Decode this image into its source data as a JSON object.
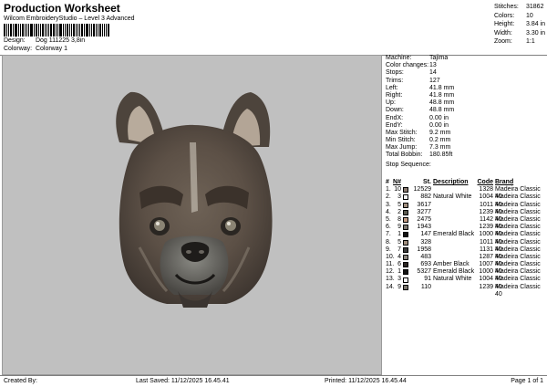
{
  "header": {
    "title": "Production Worksheet",
    "subtitle": "Wilcom EmbroideryStudio – Level 3 Advanced",
    "design_label": "Design:",
    "design_value": "Dog 111225 3,8in",
    "colorway_label": "Colorway:",
    "colorway_value": "Colorway 1"
  },
  "stats": [
    {
      "label": "Stitches:",
      "value": "31862"
    },
    {
      "label": "Colors:",
      "value": "10"
    },
    {
      "label": "Height:",
      "value": "3.84 in"
    },
    {
      "label": "Width:",
      "value": "3.30 in"
    },
    {
      "label": "Zoom:",
      "value": "1:1"
    }
  ],
  "specs": [
    {
      "label": "Machine:",
      "value": "Tajima"
    },
    {
      "label": "Color changes:",
      "value": "13"
    },
    {
      "label": "Stops:",
      "value": "14"
    },
    {
      "label": "Trims:",
      "value": "127"
    },
    {
      "label": "Left:",
      "value": "41.8 mm"
    },
    {
      "label": "Right:",
      "value": "41.8 mm"
    },
    {
      "label": "Up:",
      "value": "48.8 mm"
    },
    {
      "label": "Down:",
      "value": "48.8 mm"
    },
    {
      "label": "EndX:",
      "value": "0.00 in"
    },
    {
      "label": "EndY:",
      "value": "0.00 in"
    },
    {
      "label": "Max Stitch:",
      "value": "9.2 mm"
    },
    {
      "label": "Min Stitch:",
      "value": "0.2 mm"
    },
    {
      "label": "Max Jump:",
      "value": "7.3 mm"
    },
    {
      "label": "Total Bobbin:",
      "value": "180.85ft"
    }
  ],
  "stop_sequence": {
    "title": "Stop Sequence:",
    "headers": {
      "hash": "#",
      "n": "N#",
      "st": "St.",
      "desc": "Description",
      "code": "Code",
      "brand": "Brand"
    },
    "rows": [
      {
        "hash": "1.",
        "n": "10",
        "color": "#8a7a70",
        "st": "12529",
        "desc": "",
        "code": "1328",
        "brand": "Madeira Classic 40"
      },
      {
        "hash": "2.",
        "n": "3",
        "color": "#f4f4f4",
        "st": "882",
        "desc": "Natural White",
        "code": "1004",
        "brand": "Madeira Classic 40"
      },
      {
        "hash": "3.",
        "n": "5",
        "color": "#a08e7e",
        "st": "3617",
        "desc": "",
        "code": "1011",
        "brand": "Madeira Classic 40"
      },
      {
        "hash": "4.",
        "n": "2",
        "color": "#5b5a50",
        "st": "3277",
        "desc": "",
        "code": "1239",
        "brand": "Madeira Classic 40"
      },
      {
        "hash": "5.",
        "n": "8",
        "color": "#c19a82",
        "st": "2475",
        "desc": "",
        "code": "1142",
        "brand": "Madeira Classic 40"
      },
      {
        "hash": "6.",
        "n": "9",
        "color": "#7b766e",
        "st": "1943",
        "desc": "",
        "code": "1239",
        "brand": "Madeira Classic 40"
      },
      {
        "hash": "7.",
        "n": "1",
        "color": "#111111",
        "st": "147",
        "desc": "Emerald Black",
        "code": "1000",
        "brand": "Madeira Classic 40"
      },
      {
        "hash": "8.",
        "n": "5",
        "color": "#a08e7e",
        "st": "328",
        "desc": "",
        "code": "1011",
        "brand": "Madeira Classic 40"
      },
      {
        "hash": "9.",
        "n": "7",
        "color": "#3a3a3a",
        "st": "1958",
        "desc": "",
        "code": "1131",
        "brand": "Madeira Classic 40"
      },
      {
        "hash": "10.",
        "n": "4",
        "color": "#8b857d",
        "st": "483",
        "desc": "",
        "code": "1287",
        "brand": "Madeira Classic 40"
      },
      {
        "hash": "11.",
        "n": "6",
        "color": "#2a2522",
        "st": "693",
        "desc": "Amber Black",
        "code": "1007",
        "brand": "Madeira Classic 40"
      },
      {
        "hash": "12.",
        "n": "1",
        "color": "#111111",
        "st": "5327",
        "desc": "Emerald Black",
        "code": "1000",
        "brand": "Madeira Classic 40"
      },
      {
        "hash": "13.",
        "n": "3",
        "color": "#f4f4f4",
        "st": "91",
        "desc": "Natural White",
        "code": "1004",
        "brand": "Madeira Classic 40"
      },
      {
        "hash": "14.",
        "n": "9",
        "color": "#7b766e",
        "st": "110",
        "desc": "",
        "code": "1239",
        "brand": "Madeira Classic 40"
      }
    ]
  },
  "footer": {
    "created_by": "Created By:",
    "last_saved": "Last Saved: 11/12/2025 16.45.41",
    "printed": "Printed: 11/12/2025 16.45.44",
    "page": "Page 1 of 1"
  },
  "design_image": {
    "icon": "french-bulldog-embroidery",
    "background_color": "#c0c0c0"
  }
}
